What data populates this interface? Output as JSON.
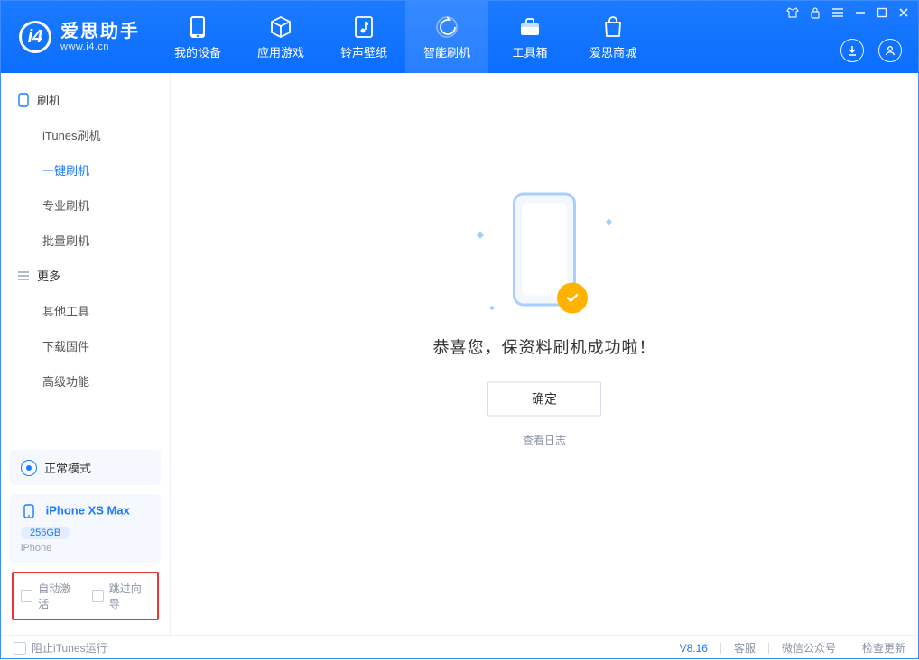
{
  "app": {
    "name_cn": "爱思助手",
    "name_en": "www.i4.cn"
  },
  "nav": {
    "items": [
      {
        "key": "device",
        "label": "我的设备"
      },
      {
        "key": "apps",
        "label": "应用游戏"
      },
      {
        "key": "media",
        "label": "铃声壁纸"
      },
      {
        "key": "flash",
        "label": "智能刷机"
      },
      {
        "key": "toolbox",
        "label": "工具箱"
      },
      {
        "key": "store",
        "label": "爱思商城"
      }
    ],
    "active_key": "flash"
  },
  "sidebar": {
    "groups": [
      {
        "key": "flash",
        "title": "刷机",
        "items": [
          {
            "key": "itunes",
            "label": "iTunes刷机"
          },
          {
            "key": "oneclick",
            "label": "一键刷机"
          },
          {
            "key": "pro",
            "label": "专业刷机"
          },
          {
            "key": "batch",
            "label": "批量刷机"
          }
        ],
        "active_key": "oneclick"
      },
      {
        "key": "more",
        "title": "更多",
        "items": [
          {
            "key": "other",
            "label": "其他工具"
          },
          {
            "key": "firmware",
            "label": "下载固件"
          },
          {
            "key": "advanced",
            "label": "高级功能"
          }
        ]
      }
    ],
    "mode_label": "正常模式",
    "device": {
      "name": "iPhone XS Max",
      "capacity": "256GB",
      "subtype": "iPhone"
    },
    "options": {
      "auto_activate": "自动激活",
      "skip_guide": "跳过向导"
    }
  },
  "main": {
    "success_message": "恭喜您，保资料刷机成功啦！",
    "ok_label": "确定",
    "view_log_label": "查看日志"
  },
  "footer": {
    "block_itunes_label": "阻止iTunes运行",
    "version": "V8.16",
    "links": {
      "support": "客服",
      "wechat": "微信公众号",
      "update": "检查更新"
    }
  }
}
